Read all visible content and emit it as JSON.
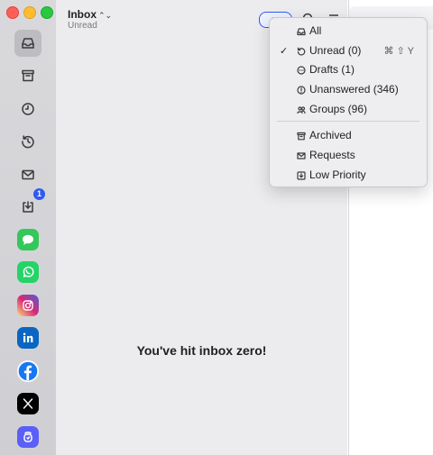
{
  "header": {
    "title": "Inbox",
    "title_caret": "⌃⌄",
    "subtitle": "Unread"
  },
  "sidebar": {
    "items": [
      {
        "name": "inbox",
        "icon": "inbox-icon",
        "active": true
      },
      {
        "name": "archive",
        "icon": "archive-icon"
      },
      {
        "name": "snoozed",
        "icon": "clock-icon"
      },
      {
        "name": "scheduled",
        "icon": "history-clock-icon"
      },
      {
        "name": "mail",
        "icon": "envelope-icon"
      },
      {
        "name": "downloads",
        "icon": "download-tray-icon",
        "badge": "1"
      },
      {
        "name": "messages",
        "icon": "messages-icon",
        "color": "#34c759"
      },
      {
        "name": "whatsapp",
        "icon": "whatsapp-icon",
        "color": "#25d366"
      },
      {
        "name": "instagram",
        "icon": "instagram-icon",
        "color": "#d62976"
      },
      {
        "name": "linkedin",
        "icon": "linkedin-icon",
        "color": "#0a66c2"
      },
      {
        "name": "facebook",
        "icon": "facebook-icon",
        "color": "#1877f2"
      },
      {
        "name": "x",
        "icon": "x-icon",
        "color": "#000000"
      },
      {
        "name": "other-app",
        "icon": "app-icon",
        "color": "#5b5ff7"
      }
    ]
  },
  "main": {
    "empty_message": "You've hit inbox zero!"
  },
  "menu": {
    "items": [
      {
        "label": "All",
        "icon": "inbox-icon"
      },
      {
        "label": "Unread (0)",
        "icon": "unread-icon",
        "checked": true,
        "check_mark": "✓",
        "shortcut": "⌘⇧Y"
      },
      {
        "label": "Drafts (1)",
        "icon": "draft-bubble-icon"
      },
      {
        "label": "Unanswered (346)",
        "icon": "exclamation-bubble-icon"
      },
      {
        "label": "Groups (96)",
        "icon": "group-icon"
      },
      {
        "label": "Archived",
        "icon": "archive-icon"
      },
      {
        "label": "Requests",
        "icon": "envelope-icon"
      },
      {
        "label": "Low Priority",
        "icon": "low-priority-icon"
      }
    ]
  },
  "colors": {
    "accent": "#2f5bf0"
  }
}
